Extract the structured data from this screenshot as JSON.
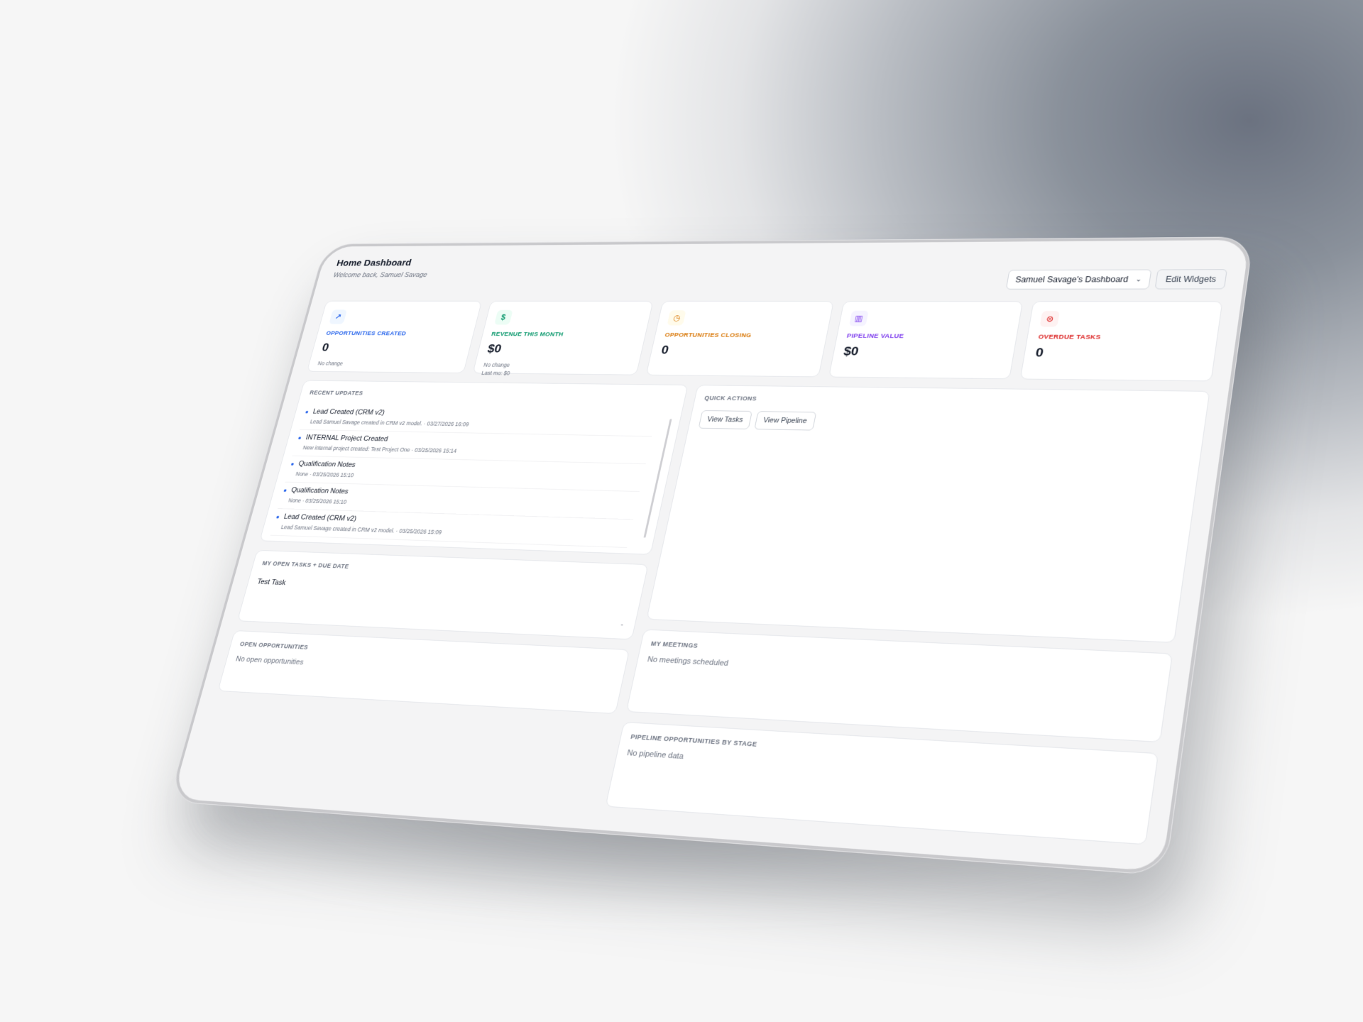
{
  "header": {
    "title": "Home Dashboard",
    "subtitle": "Welcome back, Samuel Savage",
    "dashboard_select": "Samuel Savage's Dashboard",
    "edit_widgets": "Edit Widgets"
  },
  "kpis": [
    {
      "label": "OPPORTUNITIES CREATED",
      "value": "0",
      "note1": "No change",
      "note2": "",
      "icon": "trending-up-icon",
      "color": "#2563eb",
      "bg": "#eff6ff",
      "glyph": "↗"
    },
    {
      "label": "REVENUE THIS MONTH",
      "value": "$0",
      "note1": "No change",
      "note2": "Last mo: $0",
      "icon": "dollar-icon",
      "color": "#059669",
      "bg": "#ecfdf5",
      "glyph": "$"
    },
    {
      "label": "OPPORTUNITIES CLOSING",
      "value": "0",
      "note1": "",
      "note2": "",
      "icon": "clock-icon",
      "color": "#d97706",
      "bg": "#fffbeb",
      "glyph": "◷"
    },
    {
      "label": "PIPELINE VALUE",
      "value": "$0",
      "note1": "",
      "note2": "",
      "icon": "bar-chart-icon",
      "color": "#7c3aed",
      "bg": "#f5f3ff",
      "glyph": "▥"
    },
    {
      "label": "OVERDUE TASKS",
      "value": "0",
      "note1": "",
      "note2": "",
      "icon": "alert-circle-icon",
      "color": "#dc2626",
      "bg": "#fef2f2",
      "glyph": "⊙"
    }
  ],
  "recent_updates": {
    "title": "RECENT UPDATES",
    "items": [
      {
        "title": "Lead Created (CRM v2)",
        "meta": "Lead Samuel Savage created in CRM v2 model. · 03/27/2026 16:09"
      },
      {
        "title": "INTERNAL Project Created",
        "meta": "New internal project created: Test Project One · 03/25/2026 15:14"
      },
      {
        "title": "Qualification Notes",
        "meta": "None · 03/25/2026 15:10"
      },
      {
        "title": "Qualification Notes",
        "meta": "None · 03/25/2026 15:10"
      },
      {
        "title": "Lead Created (CRM v2)",
        "meta": "Lead Samuel Savage created in CRM v2 model. · 03/25/2026 15:09"
      }
    ]
  },
  "tasks": {
    "title": "MY OPEN TASKS + DUE DATE",
    "task": "Test Task",
    "due": "-"
  },
  "open_opps": {
    "title": "OPEN OPPORTUNITIES",
    "empty": "No open opportunities"
  },
  "quick_actions": {
    "title": "QUICK ACTIONS",
    "view_tasks": "View Tasks",
    "view_pipeline": "View Pipeline"
  },
  "meetings": {
    "title": "MY MEETINGS",
    "empty": "No meetings scheduled"
  },
  "pipeline": {
    "title": "PIPELINE OPPORTUNITIES BY STAGE",
    "empty": "No pipeline data"
  }
}
